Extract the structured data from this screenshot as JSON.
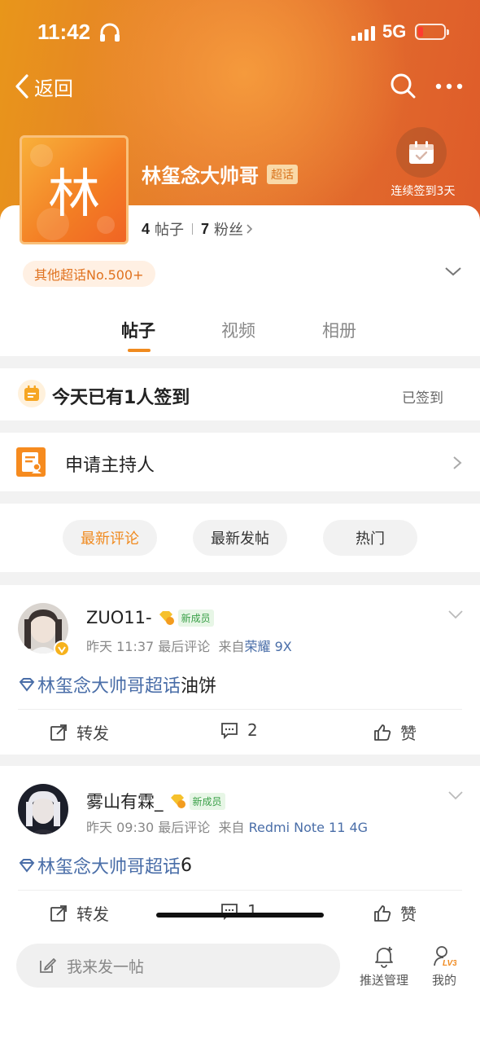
{
  "status_bar": {
    "time": "11:42",
    "network": "5G"
  },
  "nav": {
    "back_label": "返回"
  },
  "topic": {
    "avatar_char": "林",
    "name": "林玺念大帅哥",
    "badge": "超话",
    "posts_count": "4",
    "posts_label": "帖子",
    "fans_count": "7",
    "fans_label": "粉丝",
    "rank": "其他超话No.500+",
    "checkin_streak": "连续签到3天"
  },
  "tabs": [
    {
      "label": "帖子",
      "active": true
    },
    {
      "label": "视频",
      "active": false
    },
    {
      "label": "相册",
      "active": false
    }
  ],
  "checkin_bar": {
    "text": "今天已有1人签到",
    "status": "已签到"
  },
  "host_row": {
    "text": "申请主持人"
  },
  "filters": [
    {
      "label": "最新评论",
      "active": true
    },
    {
      "label": "最新发帖",
      "active": false
    },
    {
      "label": "热门",
      "active": false
    }
  ],
  "posts": [
    {
      "username": "ZUO11-",
      "badge": "新成员",
      "time": "昨天 11:37 最后评论",
      "source_prefix": "来自",
      "device": "荣耀 9X",
      "tag": "林玺念大帅哥超话",
      "text": "油饼",
      "repost_label": "转发",
      "comments": "2",
      "like_label": "赞"
    },
    {
      "username": "雾山有霖_",
      "badge": "新成员",
      "time": "昨天 09:30 最后评论",
      "source_prefix": "来自",
      "device": "Redmi Note 11 4G",
      "tag": "林玺念大帅哥超话",
      "text": "6",
      "repost_label": "转发",
      "comments": "1",
      "like_label": "赞"
    }
  ],
  "bottom": {
    "compose_placeholder": "我来发一帖",
    "push_label": "推送管理",
    "mine_label": "我的",
    "level": "LV3"
  },
  "colors": {
    "accent": "#f08a1f",
    "link": "#4a6ea8",
    "hero_start": "#e8961a",
    "hero_end": "#de5b2a"
  }
}
